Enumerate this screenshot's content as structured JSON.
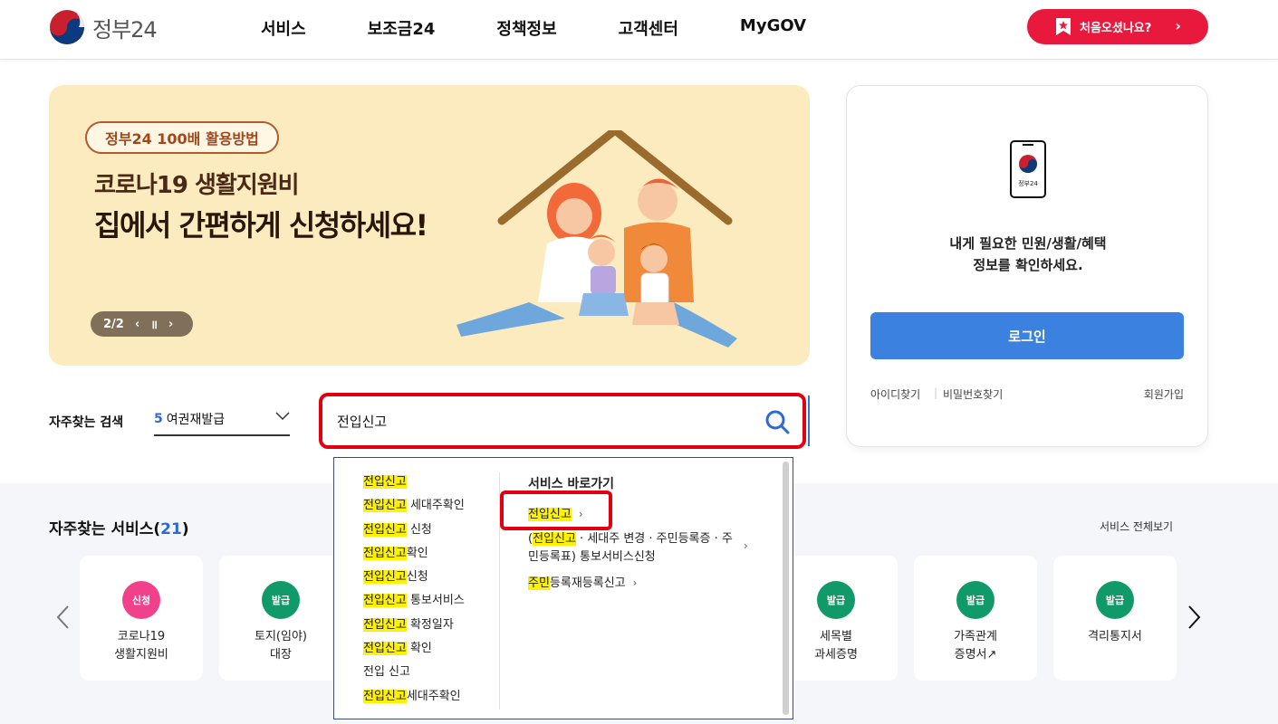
{
  "header": {
    "logo_text": "정부24",
    "nav": [
      "서비스",
      "보조금24",
      "정책정보",
      "고객센터",
      "MyGOV"
    ],
    "first_visit_label": "처음오셨나요?",
    "first_visit_arrow": "›"
  },
  "banner": {
    "tag": "정부24 100배 활용방법",
    "subtitle": "코로나19 생활지원비",
    "title": "집에서 간편하게 신청하세요!",
    "page": "2/2",
    "prev": "‹",
    "pause": "॥",
    "next": "›"
  },
  "login": {
    "phone_caption": "정부24",
    "message_line1": "내게 필요한 민원/생활/혜택",
    "message_line2": "정보를 확인하세요.",
    "login_button": "로그인",
    "find_id": "아이디찾기",
    "find_password": "비밀번호찾기",
    "signup": "회원가입"
  },
  "search": {
    "popular_label": "자주찾는 검색",
    "popular_num": "5",
    "popular_value": "여권재발급",
    "query": "전입신고"
  },
  "autocomplete": {
    "suggestions": [
      {
        "hl": "전입신고",
        "rest": ""
      },
      {
        "hl": "전입신고",
        "rest": " 세대주확인"
      },
      {
        "hl": "전입신고",
        "rest": " 신청"
      },
      {
        "hl": "전입신고",
        "rest": "확인"
      },
      {
        "hl": "전입신고",
        "rest": "신청"
      },
      {
        "hl": "전입신고",
        "rest": " 통보서비스"
      },
      {
        "hl": "전입신고",
        "rest": " 확정일자"
      },
      {
        "hl": "전입신고",
        "rest": " 확인"
      },
      {
        "hl": "",
        "rest": "전입 신고"
      },
      {
        "hl": "전입신고",
        "rest": "세대주확인"
      }
    ],
    "quick_title": "서비스 바로가기",
    "quick_1_hl": "전입신고",
    "quick_2_prefix": "(",
    "quick_2_hl": "전입신고",
    "quick_2_rest": " · 세대주 변경 · 주민등록증 · 주민등록표) 통보서비스신청",
    "quick_3_hl": "주민",
    "quick_3_rest": "등록재등록신고",
    "arrow": "›"
  },
  "services": {
    "title": "자주찾는 서비스(",
    "count": "21",
    "title_end": ")",
    "view_all": "서비스 전체보기",
    "cards": [
      {
        "badge": "신청",
        "label": "코로나19\n생활지원비",
        "color": "#f0418a"
      },
      {
        "badge": "발급",
        "label": "토지(임야)\n대장",
        "color": "#109a6a"
      },
      {
        "badge": "발급",
        "label": "세목별\n과세증명",
        "color": "#109a6a"
      },
      {
        "badge": "발급",
        "label": "가족관계\n증명서↗",
        "color": "#109a6a"
      },
      {
        "badge": "발급",
        "label": "격리통지서",
        "color": "#109a6a"
      }
    ]
  },
  "colors": {
    "brand_red": "#e8193c",
    "brand_blue": "#3b82e0",
    "highlight": "#fff200"
  }
}
